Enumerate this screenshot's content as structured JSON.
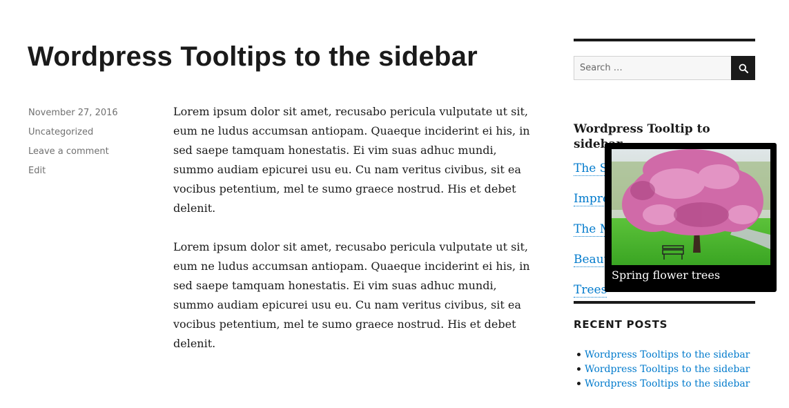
{
  "post": {
    "title": "Wordpress Tooltips to the sidebar",
    "meta": {
      "date": "November 27, 2016",
      "category": "Uncategorized",
      "comment_link": "Leave a comment",
      "edit_link": "Edit"
    },
    "paragraphs": [
      "Lorem ipsum dolor sit amet, recusabo pericula vulputate ut sit, eum ne ludus accumsan antiopam. Quaeque inciderint ei his, in sed saepe tamquam honestatis. Ei vim suas adhuc mundi, summo audiam epicurei usu eu. Cu nam veritus civibus, sit ea vocibus petentium, mel te sumo graece nostrud. His et debet delenit.",
      "Lorem ipsum dolor sit amet, recusabo pericula vulputate ut sit, eum ne ludus accumsan antiopam. Quaeque inciderint ei his, in sed saepe tamquam honestatis. Ei vim suas adhuc mundi, summo audiam epicurei usu eu. Cu nam veritus civibus, sit ea vocibus petentium, mel te sumo graece nostrud. His et debet delenit."
    ]
  },
  "sidebar": {
    "search": {
      "placeholder": "Search …",
      "button_icon": "search-icon"
    },
    "tooltip_widget": {
      "title": "Wordpress Tooltip to sidebar",
      "links": [
        "The S",
        "Impre",
        "The M",
        "Beaut",
        "Trees"
      ]
    },
    "recent_posts": {
      "heading": "RECENT POSTS",
      "items": [
        "Wordpress Tooltips to the sidebar",
        "Wordpress Tooltips to the sidebar",
        "Wordpress Tooltips to the sidebar"
      ]
    }
  },
  "tooltip": {
    "caption": "Spring flower trees",
    "image_subject": "pink blossom tree over green lawn"
  },
  "colors": {
    "link": "#007acc",
    "text": "#1a1a1a",
    "meta": "#707070",
    "tooltip_bg": "#000000"
  }
}
